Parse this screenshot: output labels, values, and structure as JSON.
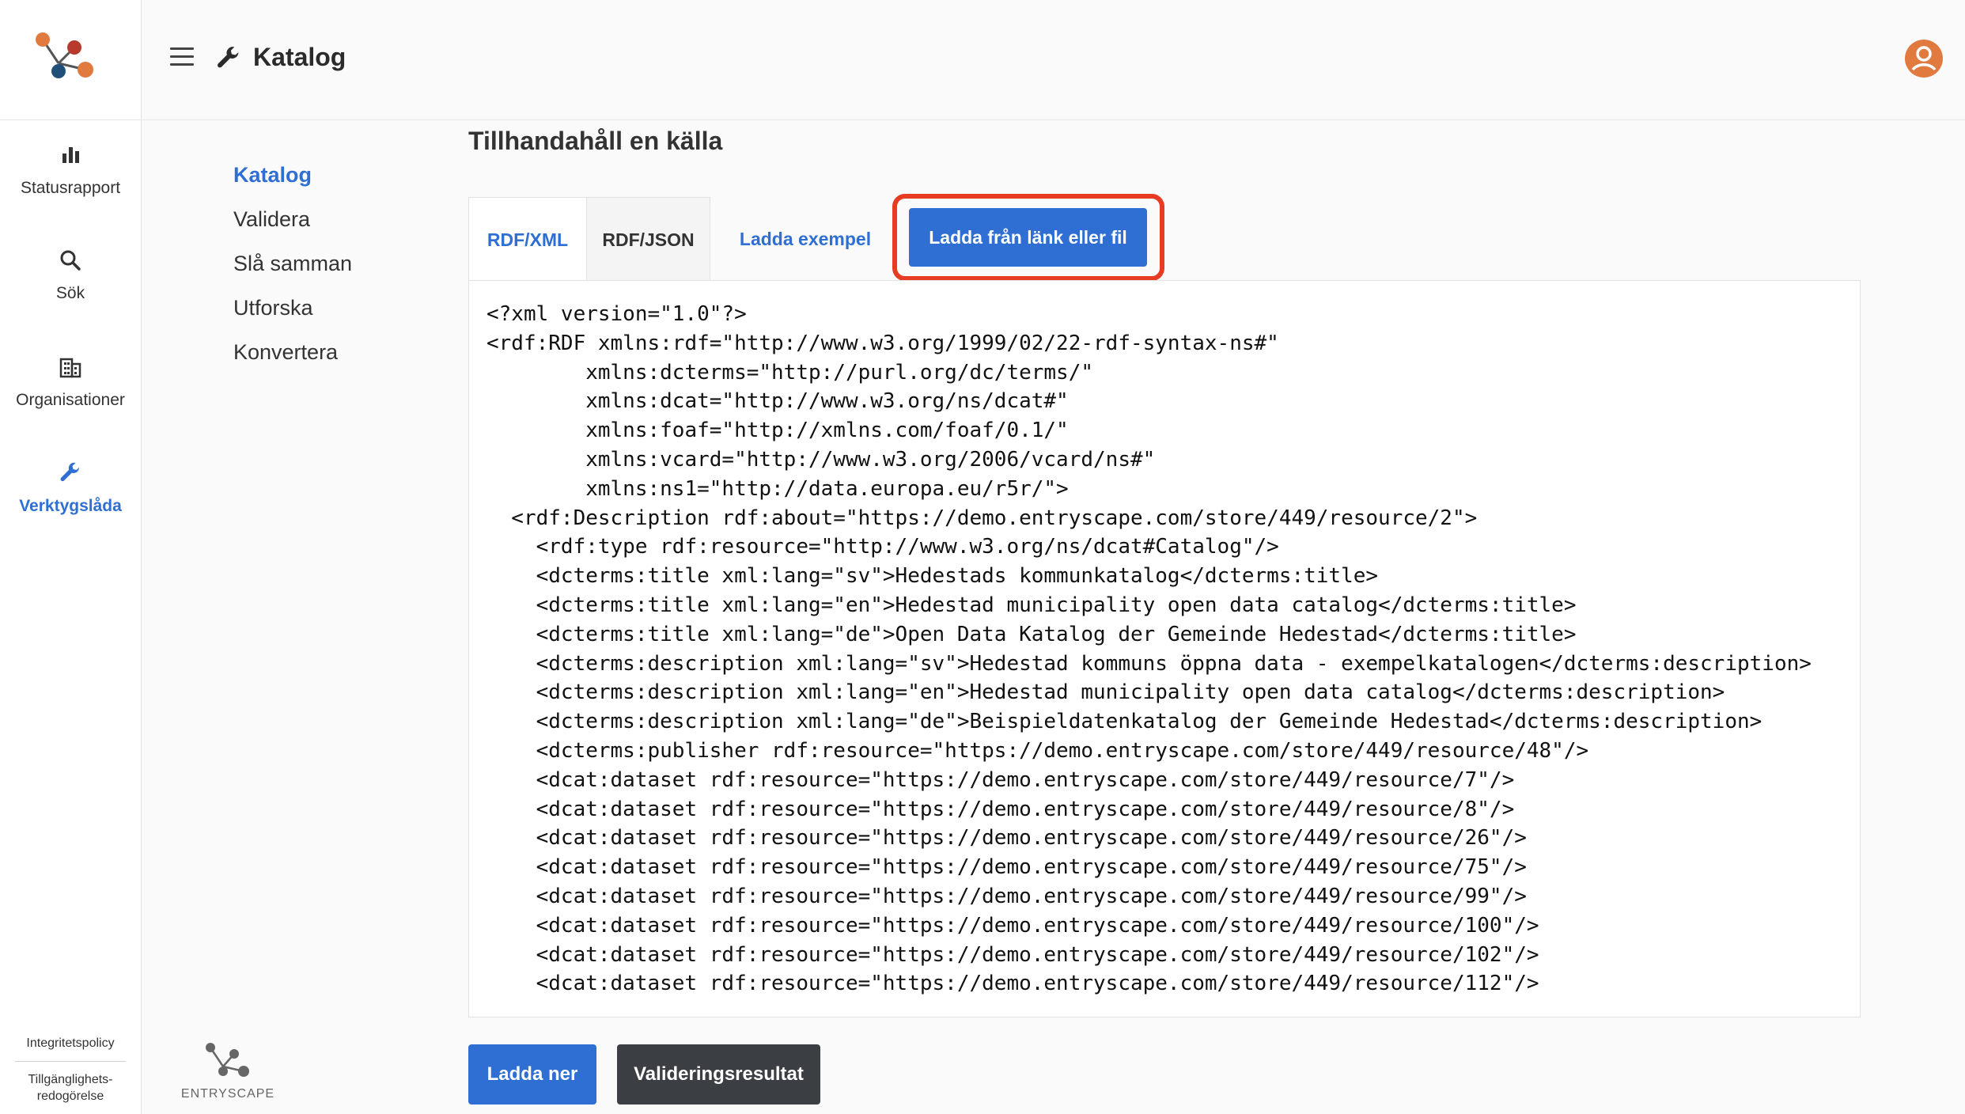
{
  "header": {
    "title": "Katalog"
  },
  "sidebar": {
    "items": [
      {
        "label": "Statusrapport",
        "icon": "bar-chart-icon"
      },
      {
        "label": "Sök",
        "icon": "search-icon"
      },
      {
        "label": "Organisationer",
        "icon": "building-icon"
      },
      {
        "label": "Verktygslåda",
        "icon": "wrench-icon",
        "active": true
      }
    ],
    "footer": {
      "privacy": "Integritetspolicy",
      "accessibility_1": "Tillgänglighets-",
      "accessibility_2": "redogörelse"
    }
  },
  "subnav": {
    "items": [
      {
        "label": "Katalog",
        "active": true
      },
      {
        "label": "Validera"
      },
      {
        "label": "Slå samman"
      },
      {
        "label": "Utforska"
      },
      {
        "label": "Konvertera"
      }
    ]
  },
  "main": {
    "title": "Tillhandahåll en källa",
    "tabs": [
      {
        "label": "RDF/XML",
        "active": true
      },
      {
        "label": "RDF/JSON"
      },
      {
        "label": "Ladda exempel"
      }
    ],
    "load_button": "Ladda från länk eller fil",
    "code": "<?xml version=\"1.0\"?>\n<rdf:RDF xmlns:rdf=\"http://www.w3.org/1999/02/22-rdf-syntax-ns#\"\n        xmlns:dcterms=\"http://purl.org/dc/terms/\"\n        xmlns:dcat=\"http://www.w3.org/ns/dcat#\"\n        xmlns:foaf=\"http://xmlns.com/foaf/0.1/\"\n        xmlns:vcard=\"http://www.w3.org/2006/vcard/ns#\"\n        xmlns:ns1=\"http://data.europa.eu/r5r/\">\n  <rdf:Description rdf:about=\"https://demo.entryscape.com/store/449/resource/2\">\n    <rdf:type rdf:resource=\"http://www.w3.org/ns/dcat#Catalog\"/>\n    <dcterms:title xml:lang=\"sv\">Hedestads kommunkatalog</dcterms:title>\n    <dcterms:title xml:lang=\"en\">Hedestad municipality open data catalog</dcterms:title>\n    <dcterms:title xml:lang=\"de\">Open Data Katalog der Gemeinde Hedestad</dcterms:title>\n    <dcterms:description xml:lang=\"sv\">Hedestad kommuns öppna data - exempelkatalogen</dcterms:description>\n    <dcterms:description xml:lang=\"en\">Hedestad municipality open data catalog</dcterms:description>\n    <dcterms:description xml:lang=\"de\">Beispieldatenkatalog der Gemeinde Hedestad</dcterms:description>\n    <dcterms:publisher rdf:resource=\"https://demo.entryscape.com/store/449/resource/48\"/>\n    <dcat:dataset rdf:resource=\"https://demo.entryscape.com/store/449/resource/7\"/>\n    <dcat:dataset rdf:resource=\"https://demo.entryscape.com/store/449/resource/8\"/>\n    <dcat:dataset rdf:resource=\"https://demo.entryscape.com/store/449/resource/26\"/>\n    <dcat:dataset rdf:resource=\"https://demo.entryscape.com/store/449/resource/75\"/>\n    <dcat:dataset rdf:resource=\"https://demo.entryscape.com/store/449/resource/99\"/>\n    <dcat:dataset rdf:resource=\"https://demo.entryscape.com/store/449/resource/100\"/>\n    <dcat:dataset rdf:resource=\"https://demo.entryscape.com/store/449/resource/102\"/>\n    <dcat:dataset rdf:resource=\"https://demo.entryscape.com/store/449/resource/112\"/>",
    "download_button": "Ladda ner",
    "validation_button": "Valideringsresultat"
  },
  "brand": {
    "name": "ENTRYSCAPE"
  },
  "colors": {
    "accent": "#2f6fd3",
    "highlight": "#e83b24",
    "avatar": "#e07a3f"
  }
}
